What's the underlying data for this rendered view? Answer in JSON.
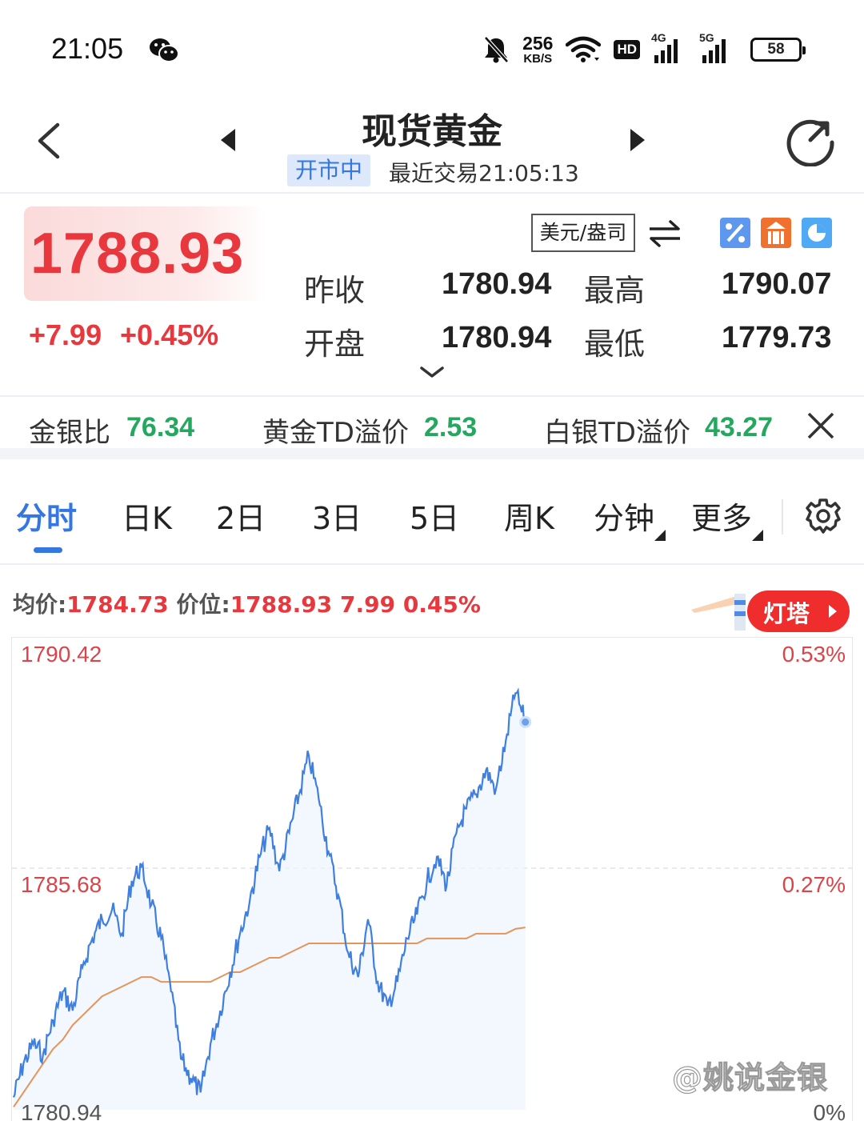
{
  "status_bar": {
    "time": "21:05",
    "net_speed_value": "256",
    "net_speed_unit": "KB/S",
    "hd_label": "HD",
    "signal_1_label": "4G",
    "signal_2_label": "5G",
    "battery": "58",
    "icons": [
      "wechat-icon",
      "bell-muted-icon",
      "wifi-icon",
      "signal-icon",
      "battery-icon"
    ]
  },
  "header": {
    "title": "现货黄金",
    "market_status": "开市中",
    "last_trade": "最近交易21:05:13",
    "icons": [
      "back-icon",
      "prev-icon",
      "next-icon",
      "refresh-icon"
    ]
  },
  "quote": {
    "last_price": "1788.93",
    "change_abs": "+7.99",
    "change_pct": "+0.45%",
    "currency_unit": "美元/盎司",
    "prev_close_label": "昨收",
    "prev_close": "1780.94",
    "open_label": "开盘",
    "open": "1780.94",
    "high_label": "最高",
    "high": "1790.07",
    "low_label": "最低",
    "low": "1779.73",
    "up_color": "#e8383d"
  },
  "ratios": {
    "gold_silver_label": "金银比",
    "gold_silver": "76.34",
    "gold_td_label": "黄金TD溢价",
    "gold_td": "2.53",
    "silver_td_label": "白银TD溢价",
    "silver_td": "43.27",
    "value_color": "#25a760"
  },
  "tabs": [
    {
      "label": "分时",
      "active": true
    },
    {
      "label": "日K"
    },
    {
      "label": "2日"
    },
    {
      "label": "3日"
    },
    {
      "label": "5日"
    },
    {
      "label": "周K"
    },
    {
      "label": "分钟",
      "dropdown": true
    },
    {
      "label": "更多",
      "dropdown": true
    }
  ],
  "chart_info": {
    "avg_label": "均价:",
    "avg_value": "1784.73",
    "price_label": "价位:",
    "price_value": "1788.93",
    "change": "7.99",
    "pct": "0.45%"
  },
  "lighthouse_label": "灯塔",
  "watermark": "@姚说金银",
  "chart_data": {
    "type": "line",
    "title": "",
    "xlabel": "",
    "ylabel": "",
    "ylim": [
      1780.94,
      1790.42
    ],
    "y_ticks_left": [
      "1790.42",
      "1785.68",
      "1780.94"
    ],
    "y_ticks_right": [
      "0.53%",
      "0.27%",
      "0%"
    ],
    "x_range_fraction_of_session": [
      0,
      0.61
    ],
    "grid": "dashed midline",
    "series": [
      {
        "color": "#3f7fe0",
        "values": [
          1781.2,
          1781.9,
          1782.3,
          1782.1,
          1782.8,
          1783.4,
          1783.0,
          1783.9,
          1784.5,
          1784.9,
          1785.1,
          1784.6,
          1785.7,
          1786.0,
          1785.2,
          1784.5,
          1783.4,
          1782.0,
          1781.6,
          1781.3,
          1782.3,
          1783.0,
          1783.8,
          1784.6,
          1785.3,
          1786.2,
          1786.8,
          1785.9,
          1786.7,
          1787.5,
          1788.3,
          1787.4,
          1786.3,
          1785.4,
          1784.2,
          1783.7,
          1784.9,
          1783.6,
          1783.1,
          1783.6,
          1784.5,
          1785.0,
          1785.7,
          1786.2,
          1785.6,
          1786.7,
          1787.2,
          1787.5,
          1788.0,
          1787.6,
          1788.6,
          1789.6,
          1789.0
        ]
      },
      {
        "color": "#e3955a",
        "values": [
          1781.0,
          1781.3,
          1781.6,
          1781.9,
          1782.2,
          1782.4,
          1782.7,
          1782.9,
          1783.1,
          1783.3,
          1783.4,
          1783.5,
          1783.6,
          1783.7,
          1783.7,
          1783.6,
          1783.6,
          1783.6,
          1783.6,
          1783.6,
          1783.6,
          1783.7,
          1783.8,
          1783.8,
          1783.9,
          1784.0,
          1784.1,
          1784.1,
          1784.2,
          1784.3,
          1784.4,
          1784.4,
          1784.4,
          1784.4,
          1784.4,
          1784.4,
          1784.4,
          1784.4,
          1784.4,
          1784.4,
          1784.4,
          1784.4,
          1784.5,
          1784.5,
          1784.5,
          1784.5,
          1784.5,
          1784.6,
          1784.6,
          1784.6,
          1784.6,
          1784.7,
          1784.73
        ]
      }
    ]
  }
}
